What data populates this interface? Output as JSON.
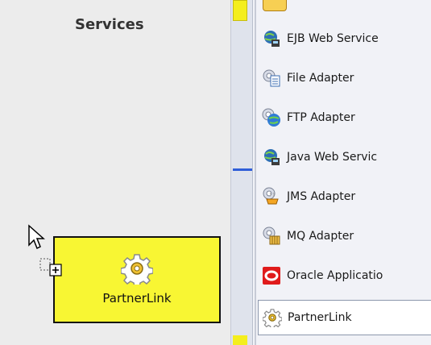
{
  "services_lane": {
    "title": "Services"
  },
  "partner_link_box": {
    "label": "PartnerLink",
    "icon": "gear-icon"
  },
  "palette": {
    "items": [
      {
        "label": "EJB Web Service",
        "icon": "ejb-web-service-icon"
      },
      {
        "label": "File Adapter",
        "icon": "file-adapter-icon"
      },
      {
        "label": "FTP Adapter",
        "icon": "ftp-adapter-icon"
      },
      {
        "label": "Java Web Servic",
        "icon": "java-web-service-icon"
      },
      {
        "label": "JMS Adapter",
        "icon": "jms-adapter-icon"
      },
      {
        "label": "MQ Adapter",
        "icon": "mq-adapter-icon"
      },
      {
        "label": "Oracle Applicatio",
        "icon": "oracle-applications-icon"
      },
      {
        "label": "PartnerLink",
        "icon": "partnerlink-icon",
        "selected": true
      }
    ]
  },
  "colors": {
    "lane_bg": "#ececec",
    "partner_box": "#f8f633",
    "palette_bg": "#f1f2f7",
    "oracle_red": "#e01b1b"
  }
}
